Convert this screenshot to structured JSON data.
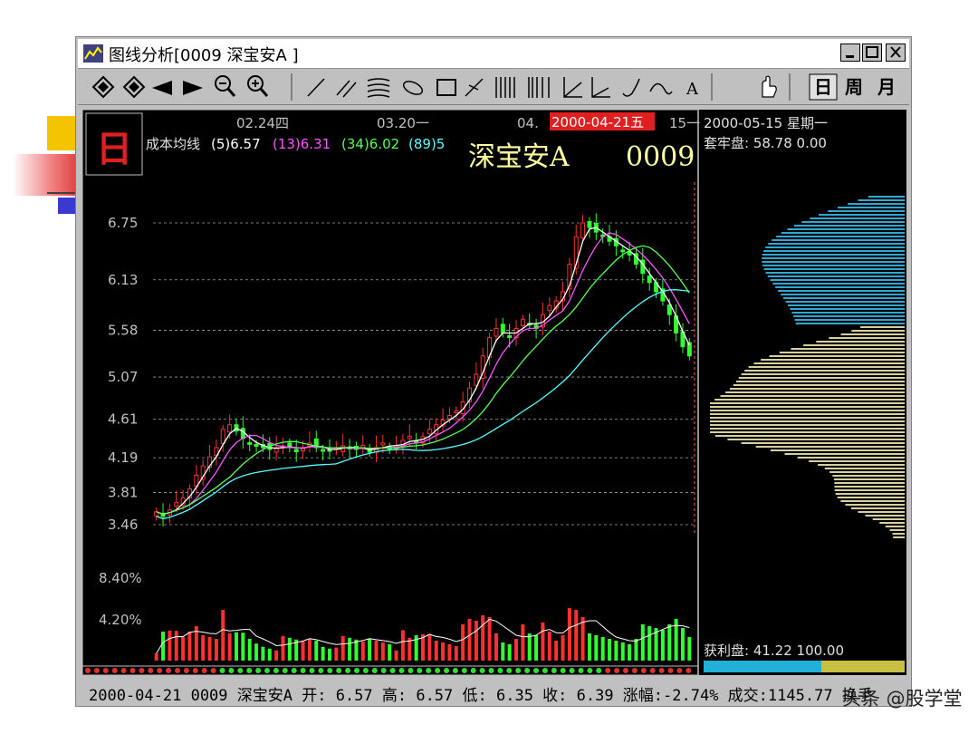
{
  "window": {
    "title": "图线分析[0009 深宝安A ]",
    "controls": [
      "minimize",
      "maximize",
      "close"
    ]
  },
  "toolbar": {
    "period_day": "日",
    "period_week": "周",
    "period_month": "月",
    "text_tool": "A"
  },
  "chart": {
    "period_badge": "日",
    "ma_label": "成本均线",
    "ma_values": [
      {
        "label": "(5)6.57",
        "color": "#ffffff"
      },
      {
        "label": "(13)6.31",
        "color": "#ff55ff"
      },
      {
        "label": "(34)6.02",
        "color": "#55ff55"
      },
      {
        "label": "(89)5",
        "color": "#55ffff"
      }
    ],
    "dates_top": [
      "02.24四",
      "03.20一",
      "04.",
      "15一"
    ],
    "highlight_date": "2000-04-21五",
    "stock_name": "深宝安A",
    "stock_code": "0009",
    "price_ticks": [
      "6.75",
      "6.13",
      "5.58",
      "5.07",
      "4.61",
      "4.19",
      "3.81",
      "3.46"
    ],
    "vol_ticks": [
      "8.40%",
      "4.20%"
    ]
  },
  "right_panel": {
    "date": "2000-05-15 星期一",
    "trapped_label": "套牢盘: 58.78 0.00",
    "profit_label": "获利盘: 41.22 100.00"
  },
  "status": {
    "text": "2000-04-21 0009 深宝安A 开: 6.57 高: 6.57 低: 6.35 收: 6.39 涨幅:-2.74% 成交:1145.77 换手"
  },
  "watermark": "头条 @股学堂",
  "chart_data": {
    "type": "candlestick",
    "x_labels": [
      "02.24四",
      "03.20一",
      "04.",
      "15一"
    ],
    "ylim": [
      3.35,
      7.0
    ],
    "y_ticks": [
      6.75,
      6.13,
      5.58,
      5.07,
      4.61,
      4.19,
      3.81,
      3.46
    ],
    "moving_averages": [
      {
        "name": "(5)",
        "value": 6.57
      },
      {
        "name": "(13)",
        "value": 6.31
      },
      {
        "name": "(34)",
        "value": 6.02
      }
    ],
    "volume_ticks": [
      "8.40%",
      "4.20%"
    ],
    "close_path": [
      3.6,
      3.55,
      3.62,
      3.7,
      3.75,
      3.85,
      4.0,
      4.1,
      4.2,
      4.3,
      4.5,
      4.55,
      4.48,
      4.4,
      4.35,
      4.32,
      4.3,
      4.28,
      4.3,
      4.32,
      4.3,
      4.28,
      4.3,
      4.35,
      4.3,
      4.28,
      4.26,
      4.3,
      4.32,
      4.3,
      4.28,
      4.3,
      4.25,
      4.3,
      4.35,
      4.3,
      4.32,
      4.38,
      4.4,
      4.35,
      4.42,
      4.5,
      4.55,
      4.6,
      4.65,
      4.7,
      4.8,
      4.95,
      5.1,
      5.3,
      5.5,
      5.6,
      5.55,
      5.5,
      5.6,
      5.7,
      5.65,
      5.6,
      5.75,
      5.85,
      5.9,
      6.0,
      6.3,
      6.6,
      6.75,
      6.7,
      6.65,
      6.6,
      6.55,
      6.5,
      6.45,
      6.4,
      6.3,
      6.2,
      6.1,
      6.0,
      5.9,
      5.75,
      5.55,
      5.4,
      5.3
    ]
  }
}
